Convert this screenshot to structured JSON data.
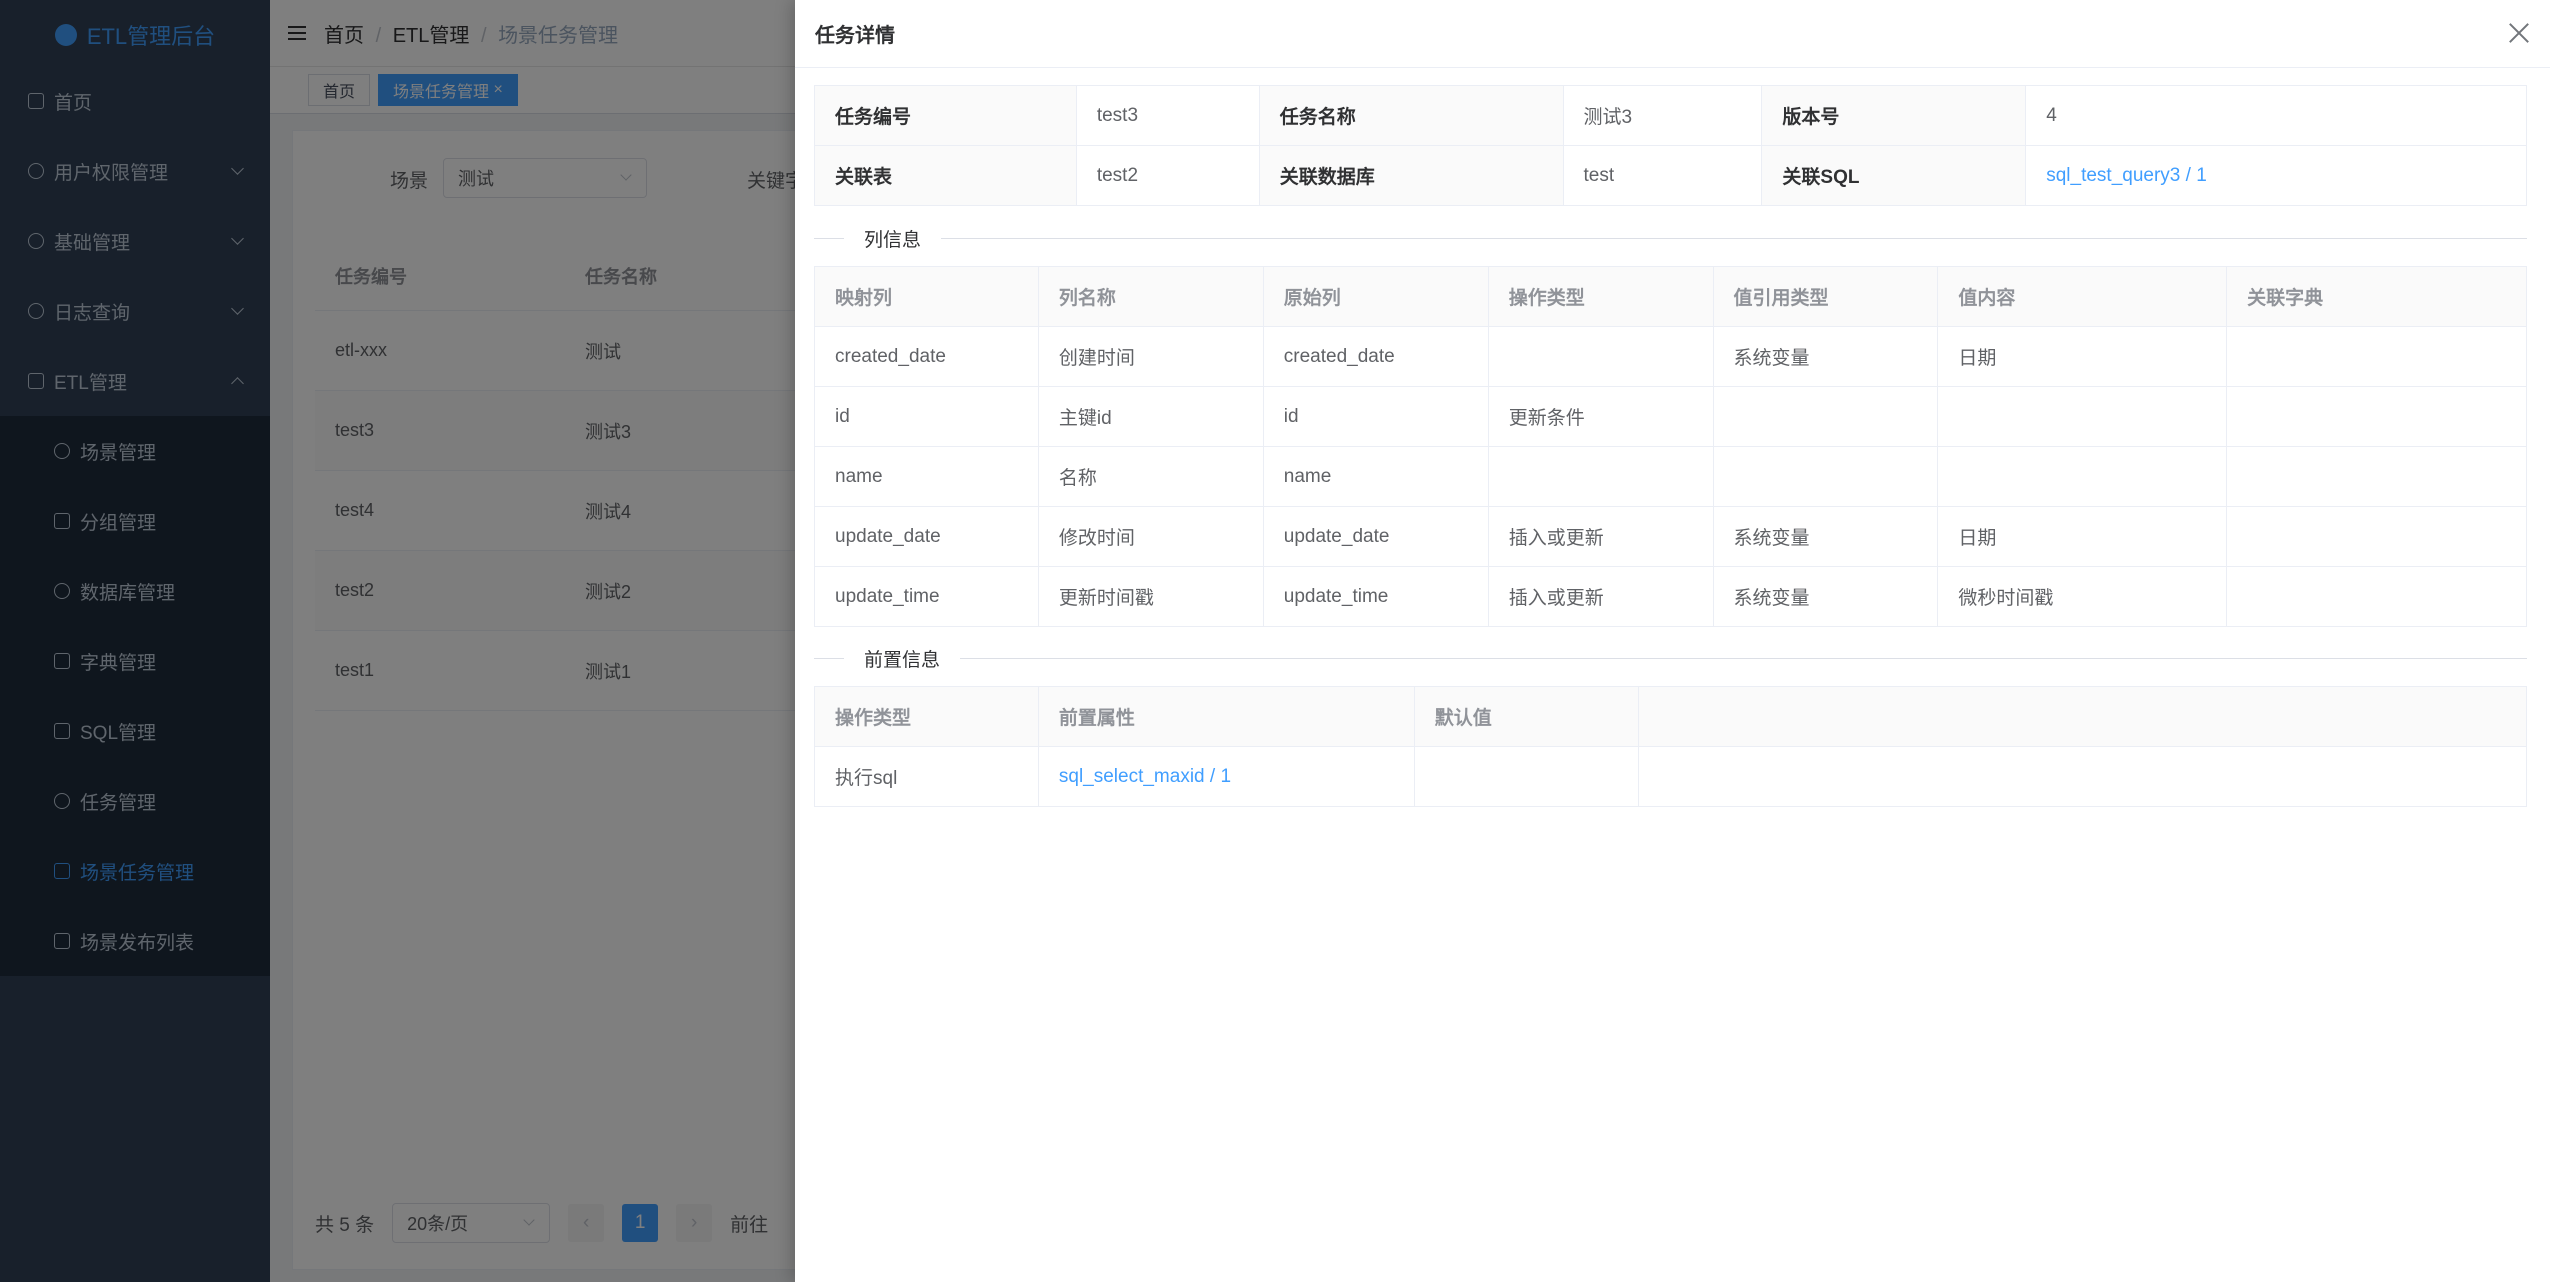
{
  "app": {
    "title": "ETL管理后台"
  },
  "sidebar": {
    "items": [
      {
        "label": "首页"
      },
      {
        "label": "用户权限管理"
      },
      {
        "label": "基础管理"
      },
      {
        "label": "日志查询"
      },
      {
        "label": "ETL管理"
      },
      {
        "label": "场景管理"
      },
      {
        "label": "分组管理"
      },
      {
        "label": "数据库管理"
      },
      {
        "label": "字典管理"
      },
      {
        "label": "SQL管理"
      },
      {
        "label": "任务管理"
      },
      {
        "label": "场景任务管理"
      },
      {
        "label": "场景发布列表"
      }
    ]
  },
  "breadcrumb": {
    "items": [
      "首页",
      "ETL管理",
      "场景任务管理"
    ]
  },
  "tags": {
    "home": "首页",
    "current": "场景任务管理"
  },
  "filter": {
    "scene_label": "场景",
    "scene_value": "测试",
    "keyword_label": "关键字"
  },
  "bg_table": {
    "headers": [
      "任务编号",
      "任务名称"
    ],
    "rows": [
      [
        "etl-xxx",
        "测试"
      ],
      [
        "test3",
        "测试3"
      ],
      [
        "test4",
        "测试4"
      ],
      [
        "test2",
        "测试2"
      ],
      [
        "test1",
        "测试1"
      ]
    ]
  },
  "pager": {
    "total": "共 5 条",
    "page_size": "20条/页",
    "current": "1",
    "goto": "前往"
  },
  "drawer": {
    "title": "任务详情",
    "desc": {
      "task_no_label": "任务编号",
      "task_no": "test3",
      "task_name_label": "任务名称",
      "task_name": "测试3",
      "version_label": "版本号",
      "version": "4",
      "rel_table_label": "关联表",
      "rel_table": "test2",
      "rel_db_label": "关联数据库",
      "rel_db": "test",
      "rel_sql_label": "关联SQL",
      "rel_sql": "sql_test_query3 / 1"
    },
    "columns_section": "列信息",
    "columns": {
      "headers": [
        "映射列",
        "列名称",
        "原始列",
        "操作类型",
        "值引用类型",
        "值内容",
        "关联字典"
      ],
      "rows": [
        [
          "created_date",
          "创建时间",
          "created_date",
          "",
          "系统变量",
          "日期",
          ""
        ],
        [
          "id",
          "主键id",
          "id",
          "更新条件",
          "",
          "",
          ""
        ],
        [
          "name",
          "名称",
          "name",
          "",
          "",
          "",
          ""
        ],
        [
          "update_date",
          "修改时间",
          "update_date",
          "插入或更新",
          "系统变量",
          "日期",
          ""
        ],
        [
          "update_time",
          "更新时间戳",
          "update_time",
          "插入或更新",
          "系统变量",
          "微秒时间戳",
          ""
        ]
      ]
    },
    "pre_section": "前置信息",
    "pre": {
      "headers": [
        "操作类型",
        "前置属性",
        "默认值"
      ],
      "rows": [
        [
          "执行sql",
          "sql_select_maxid / 1",
          ""
        ]
      ]
    }
  }
}
